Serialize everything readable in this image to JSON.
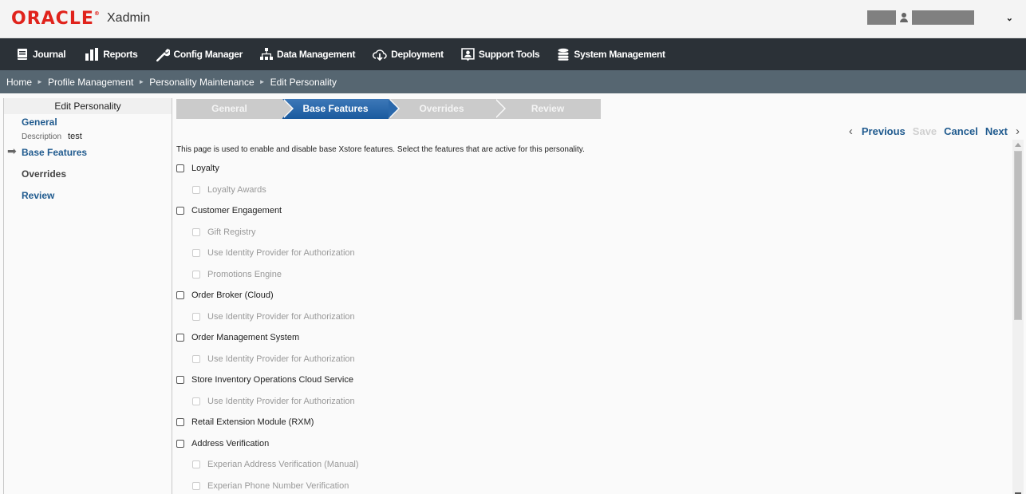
{
  "header": {
    "brand": "ORACLE",
    "app_name": "Xadmin",
    "user_menu_caret": "⌄"
  },
  "nav": {
    "items": [
      {
        "label": "Journal",
        "icon": "journal-book-icon"
      },
      {
        "label": "Reports",
        "icon": "bar-chart-icon"
      },
      {
        "label": "Config Manager",
        "icon": "wrench-icon"
      },
      {
        "label": "Data Management",
        "icon": "hierarchy-icon"
      },
      {
        "label": "Deployment",
        "icon": "cloud-download-icon"
      },
      {
        "label": "Support Tools",
        "icon": "support-person-icon"
      },
      {
        "label": "System Management",
        "icon": "database-icon"
      }
    ]
  },
  "breadcrumb": {
    "items": [
      "Home",
      "Profile Management",
      "Personality Maintenance",
      "Edit Personality"
    ],
    "separator": "►"
  },
  "sidebar": {
    "title": "Edit Personality",
    "general": "General",
    "description_label": "Description",
    "description_value": "test",
    "base_features": "Base Features",
    "overrides": "Overrides",
    "review": "Review",
    "current_marker": "➡"
  },
  "wizard": {
    "steps": [
      {
        "label": "General",
        "active": false
      },
      {
        "label": "Base Features",
        "active": true
      },
      {
        "label": "Overrides",
        "active": false
      },
      {
        "label": "Review",
        "active": false
      }
    ]
  },
  "actions": {
    "prev_chevron": "‹",
    "previous": "Previous",
    "save": "Save",
    "cancel": "Cancel",
    "next": "Next",
    "next_chevron": "›"
  },
  "intro_text": "This page is used to enable and disable base Xstore features. Select the features that are active for this personality.",
  "features": [
    {
      "label": "Loyalty",
      "level": "top",
      "checked": false,
      "enabled": true
    },
    {
      "label": "Loyalty Awards",
      "level": "sub",
      "checked": false,
      "enabled": false
    },
    {
      "label": "Customer Engagement",
      "level": "top",
      "checked": false,
      "enabled": true
    },
    {
      "label": "Gift Registry",
      "level": "sub",
      "checked": false,
      "enabled": false
    },
    {
      "label": "Use Identity Provider for Authorization",
      "level": "sub",
      "checked": false,
      "enabled": false
    },
    {
      "label": "Promotions Engine",
      "level": "sub",
      "checked": false,
      "enabled": false
    },
    {
      "label": "Order Broker (Cloud)",
      "level": "top",
      "checked": false,
      "enabled": true
    },
    {
      "label": "Use Identity Provider for Authorization",
      "level": "sub",
      "checked": false,
      "enabled": false
    },
    {
      "label": "Order Management System",
      "level": "top",
      "checked": false,
      "enabled": true
    },
    {
      "label": "Use Identity Provider for Authorization",
      "level": "sub",
      "checked": false,
      "enabled": false
    },
    {
      "label": "Store Inventory Operations Cloud Service",
      "level": "top",
      "checked": false,
      "enabled": true
    },
    {
      "label": "Use Identity Provider for Authorization",
      "level": "sub",
      "checked": false,
      "enabled": false
    },
    {
      "label": "Retail Extension Module (RXM)",
      "level": "top",
      "checked": false,
      "enabled": true
    },
    {
      "label": "Address Verification",
      "level": "top",
      "checked": false,
      "enabled": true
    },
    {
      "label": "Experian Address Verification (Manual)",
      "level": "sub",
      "checked": false,
      "enabled": false
    },
    {
      "label": "Experian Phone Number Verification",
      "level": "sub",
      "checked": false,
      "enabled": false
    }
  ],
  "colors": {
    "brand_red": "#e0231c",
    "link_blue": "#1f5a8e",
    "nav_bg": "#2b3137",
    "breadcrumb_bg": "#566671",
    "active_step": "#2a68ab"
  }
}
